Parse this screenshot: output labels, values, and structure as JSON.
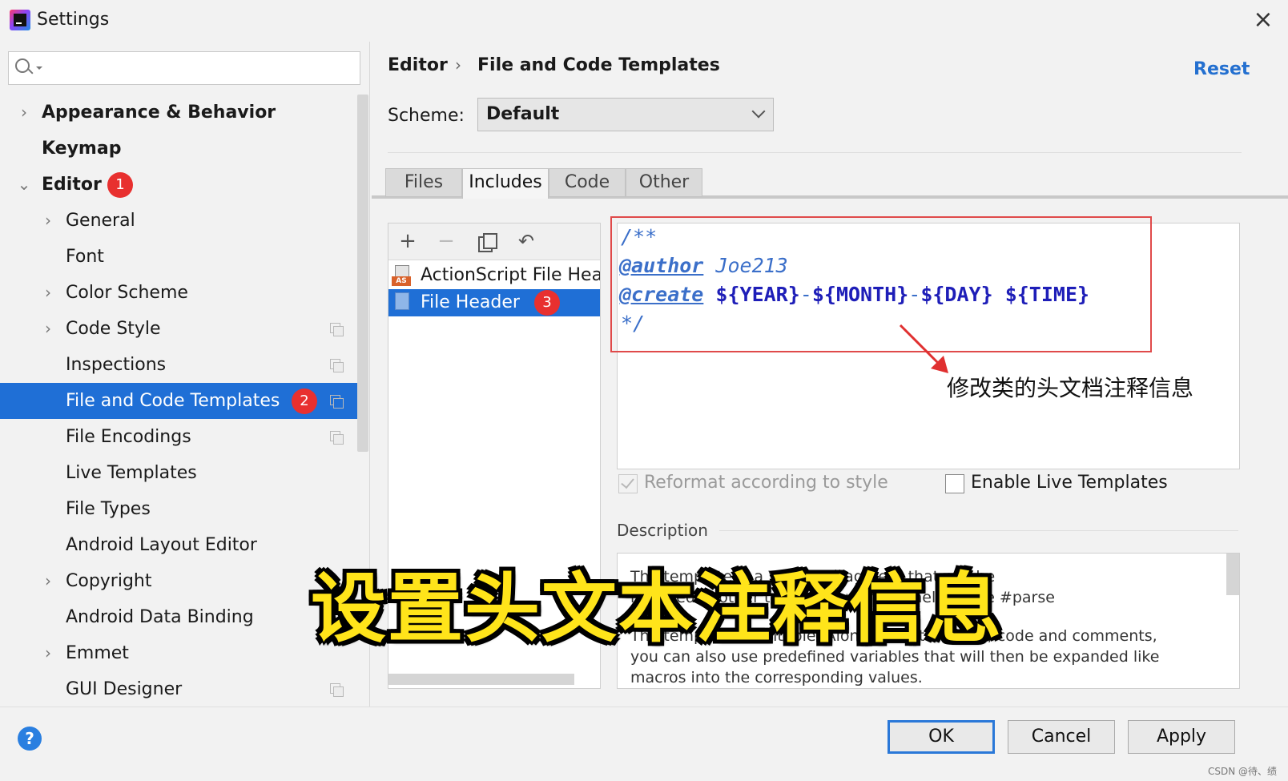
{
  "window": {
    "title": "Settings"
  },
  "search": {
    "value": "",
    "placeholder": ""
  },
  "sidebar": {
    "items": [
      {
        "label": "Appearance & Behavior"
      },
      {
        "label": "Keymap"
      },
      {
        "label": "Editor",
        "badge": "1"
      },
      {
        "label": "General"
      },
      {
        "label": "Font"
      },
      {
        "label": "Color Scheme"
      },
      {
        "label": "Code Style"
      },
      {
        "label": "Inspections"
      },
      {
        "label": "File and Code Templates",
        "badge": "2"
      },
      {
        "label": "File Encodings"
      },
      {
        "label": "Live Templates"
      },
      {
        "label": "File Types"
      },
      {
        "label": "Android Layout Editor"
      },
      {
        "label": "Copyright"
      },
      {
        "label": "Android Data Binding"
      },
      {
        "label": "Emmet"
      },
      {
        "label": "GUI Designer"
      }
    ]
  },
  "header": {
    "breadcrumb_parent": "Editor",
    "breadcrumb_sep": "›",
    "breadcrumb_current": "File and Code Templates",
    "reset_label": "Reset"
  },
  "scheme": {
    "label": "Scheme:",
    "value": "Default"
  },
  "tabs": [
    {
      "label": "Files"
    },
    {
      "label": "Includes"
    },
    {
      "label": "Code"
    },
    {
      "label": "Other"
    }
  ],
  "template_list": {
    "items": [
      {
        "label": "ActionScript File Header",
        "icon_tag": "AS"
      },
      {
        "label": "File Header",
        "badge": "3"
      }
    ]
  },
  "editor": {
    "line1": "/**",
    "author_tag": "@author",
    "author_value": " Joe213",
    "create_tag": "@create",
    "var_year": "${YEAR}",
    "var_month": "${MONTH}",
    "var_day": "${DAY}",
    "var_time": "${TIME}",
    "dash": "-",
    "space": " ",
    "line4": "*/"
  },
  "annotation": {
    "text": "修改类的头文档注释信息"
  },
  "options": {
    "reformat_label": "Reformat according to style",
    "live_templates_label": "Enable Live Templates"
  },
  "description": {
    "label": "Description",
    "text_line1": "The template is a Velocity fragment that can be",
    "text_line2": "included in other templates with the help of the #parse",
    "text_line3": "The template is editable. Along with static text, code and comments,",
    "text_line4": "you can also use predefined variables that will then be expanded like",
    "text_line5": "macros into the corresponding values."
  },
  "subtitle": {
    "text": "设置头文本注释信息"
  },
  "buttons": {
    "ok": "OK",
    "cancel": "Cancel",
    "apply": "Apply",
    "help": "?"
  },
  "watermark": "CSDN @待、绩"
}
